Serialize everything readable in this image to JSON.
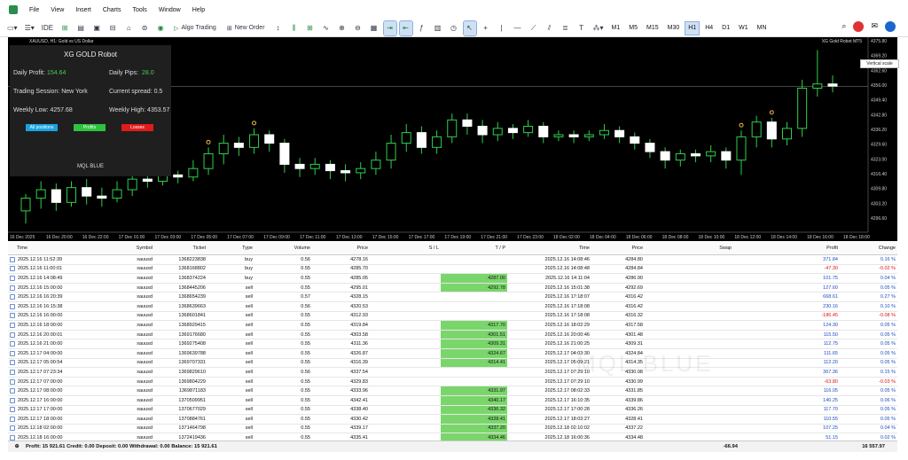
{
  "menu": [
    "File",
    "View",
    "Insert",
    "Charts",
    "Tools",
    "Window",
    "Help"
  ],
  "toolbar": {
    "algo_trading": "Algo Trading",
    "new_order": "New Order"
  },
  "timeframes": [
    "M1",
    "M5",
    "M15",
    "M30",
    "H1",
    "H4",
    "D1",
    "W1",
    "MN"
  ],
  "active_timeframe": "H1",
  "chart": {
    "symbol_label": "XAUUSD, H1:  Gold vs US Dollar",
    "robot_label": "XG Gold Robot MT5",
    "tooltip": "Vertical scale",
    "price_axis": [
      "4375.80",
      "4369.20",
      "4362.60",
      "4356.00",
      "4349.40",
      "4342.80",
      "4336.20",
      "4329.60",
      "4323.00",
      "4316.40",
      "4309.80",
      "4303.20",
      "4296.60"
    ],
    "time_axis": [
      "16 Dec 2025",
      "16 Dec 20:00",
      "16 Dec 22:00",
      "17 Dec 01:00",
      "17 Dec 03:00",
      "17 Dec 05:00",
      "17 Dec 07:00",
      "17 Dec 09:00",
      "17 Dec 11:00",
      "17 Dec 13:00",
      "17 Dec 15:00",
      "17 Dec 17:00",
      "17 Dec 19:00",
      "17 Dec 21:00",
      "17 Dec 23:00",
      "18 Dec 02:00",
      "18 Dec 04:00",
      "18 Dec 06:00",
      "18 Dec 08:00",
      "18 Dec 10:00",
      "18 Dec 12:00",
      "18 Dec 14:00",
      "18 Dec 16:00",
      "18 Dec 18:00"
    ],
    "candles": [
      [
        4298,
        4304,
        4292,
        4306
      ],
      [
        4304,
        4308,
        4299,
        4312
      ],
      [
        4308,
        4302,
        4298,
        4311
      ],
      [
        4302,
        4309,
        4300,
        4312
      ],
      [
        4309,
        4305,
        4301,
        4313
      ],
      [
        4305,
        4304,
        4300,
        4309
      ],
      [
        4304,
        4308,
        4302,
        4312
      ],
      [
        4308,
        4313,
        4305,
        4316
      ],
      [
        4313,
        4312,
        4309,
        4316
      ],
      [
        4312,
        4315,
        4310,
        4318
      ],
      [
        4315,
        4314,
        4311,
        4317
      ],
      [
        4314,
        4318,
        4312,
        4322
      ],
      [
        4318,
        4325,
        4315,
        4328
      ],
      [
        4325,
        4330,
        4320,
        4334
      ],
      [
        4330,
        4328,
        4324,
        4333
      ],
      [
        4328,
        4334,
        4325,
        4337
      ],
      [
        4334,
        4330,
        4326,
        4336
      ],
      [
        4330,
        4320,
        4316,
        4332
      ],
      [
        4320,
        4318,
        4314,
        4323
      ],
      [
        4318,
        4320,
        4315,
        4323
      ],
      [
        4320,
        4317,
        4313,
        4322
      ],
      [
        4317,
        4316,
        4312,
        4320
      ],
      [
        4316,
        4318,
        4313,
        4321
      ],
      [
        4318,
        4322,
        4315,
        4326
      ],
      [
        4322,
        4330,
        4318,
        4334
      ],
      [
        4330,
        4335,
        4326,
        4339
      ],
      [
        4335,
        4328,
        4325,
        4338
      ],
      [
        4328,
        4333,
        4325,
        4336
      ],
      [
        4333,
        4341,
        4330,
        4344
      ],
      [
        4341,
        4338,
        4334,
        4344
      ],
      [
        4338,
        4334,
        4330,
        4341
      ],
      [
        4334,
        4337,
        4331,
        4340
      ],
      [
        4337,
        4335,
        4332,
        4339
      ],
      [
        4335,
        4338,
        4333,
        4341
      ],
      [
        4338,
        4333,
        4330,
        4340
      ],
      [
        4333,
        4334,
        4331,
        4336
      ],
      [
        4334,
        4333,
        4330,
        4336
      ],
      [
        4333,
        4334,
        4331,
        4336
      ],
      [
        4334,
        4336,
        4332,
        4339
      ],
      [
        4336,
        4333,
        4330,
        4338
      ],
      [
        4333,
        4330,
        4327,
        4335
      ],
      [
        4330,
        4326,
        4323,
        4332
      ],
      [
        4326,
        4322,
        4318,
        4328
      ],
      [
        4322,
        4325,
        4319,
        4327
      ],
      [
        4325,
        4324,
        4321,
        4327
      ],
      [
        4324,
        4326,
        4321,
        4329
      ],
      [
        4326,
        4322,
        4318,
        4328
      ],
      [
        4322,
        4333,
        4315,
        4336
      ],
      [
        4333,
        4340,
        4328,
        4343
      ],
      [
        4340,
        4332,
        4328,
        4342
      ],
      [
        4332,
        4337,
        4329,
        4340
      ],
      [
        4337,
        4356,
        4333,
        4360
      ],
      [
        4356,
        4358,
        4352,
        4374
      ],
      [
        4358,
        4357,
        4354,
        4362
      ]
    ],
    "sell_markers": [
      47,
      49
    ],
    "buy_markers": [
      12,
      15
    ],
    "crosshair_price": 4356.8
  },
  "panel": {
    "title": "XG GOLD Robot",
    "daily_profit_label": "Daily Profit:",
    "daily_profit_value": "154.64",
    "daily_pips_label": "Daily Pips:",
    "daily_pips_value": "28.0",
    "trading_session": "Trading Session: New York",
    "current_spread": "Current spread: 0.5",
    "weekly_low": "Weekly Low: 4257.68",
    "weekly_high": "Weekly High: 4353.57",
    "btn_all": "All positions",
    "btn_profit": "Profits",
    "btn_loss": "Losses",
    "brand": "MQL BLUE"
  },
  "table": {
    "headers": {
      "time": "Time",
      "symbol": "Symbol",
      "ticket": "Ticket",
      "type": "Type",
      "volume": "Volume",
      "price": "Price",
      "sl": "S / L",
      "tp": "T / P",
      "ctime": "Time",
      "cprice": "Price",
      "swap": "Swap",
      "profit": "Profit",
      "change": "Change"
    },
    "rows": [
      [
        "2025.12.16 11:52:39",
        "xauusd",
        "1368223838",
        "buy",
        "0.56",
        "4278.16",
        "",
        "",
        "2025.12.16 14:08:46",
        "4284.80",
        "",
        "371.84",
        "0.16 %"
      ],
      [
        "2025.12.16 11:00:01",
        "xauusd",
        "1368168802",
        "buy",
        "0.55",
        "4285.70",
        "",
        "",
        "2025.12.16 14:08:48",
        "4284.84",
        "",
        "-47.30",
        "-0.02 %"
      ],
      [
        "2025.12.16 14:08:49",
        "xauusd",
        "1368374224",
        "buy",
        "0.55",
        "4285.05",
        "",
        "4287.00",
        "2025.12.16 14:11:04",
        "4286.90",
        "",
        "101.75",
        "0.04 %"
      ],
      [
        "2025.12.16 15:00:00",
        "xauusd",
        "1368445206",
        "sell",
        "0.55",
        "4295.01",
        "",
        "4292.78",
        "2025.12.16 15:01:38",
        "4292.69",
        "",
        "127.60",
        "0.05 %"
      ],
      [
        "2025.12.16 16:20:39",
        "xauusd",
        "1368654239",
        "sell",
        "0.57",
        "4328.15",
        "",
        "",
        "2025.12.16 17:18:07",
        "4316.42",
        "",
        "668.61",
        "0.27 %"
      ],
      [
        "2025.12.16 16:15:38",
        "xauusd",
        "1368639663",
        "sell",
        "0.56",
        "4320.53",
        "",
        "",
        "2025.12.16 17:18:08",
        "4316.42",
        "",
        "230.16",
        "0.10 %"
      ],
      [
        "2025.12.16 16:00:00",
        "xauusd",
        "1368601841",
        "sell",
        "0.55",
        "4312.93",
        "",
        "",
        "2025.12.16 17:18:08",
        "4316.32",
        "",
        "-186.45",
        "-0.08 %"
      ],
      [
        "2025.12.16 18:00:00",
        "xauusd",
        "1368929415",
        "sell",
        "0.55",
        "4319.84",
        "",
        "4317.70",
        "2025.12.16 18:02:29",
        "4317.58",
        "",
        "124.30",
        "0.05 %"
      ],
      [
        "2025.12.16 20:00:01",
        "xauusd",
        "1369176680",
        "sell",
        "0.55",
        "4303.58",
        "",
        "4301.51",
        "2025.12.16 20:00:46",
        "4301.48",
        "",
        "115.50",
        "0.05 %"
      ],
      [
        "2025.12.16 21:00:00",
        "xauusd",
        "1369275408",
        "sell",
        "0.55",
        "4311.36",
        "",
        "4309.31",
        "2025.12.16 21:00:25",
        "4309.31",
        "",
        "112.75",
        "0.05 %"
      ],
      [
        "2025.12.17 04:00:00",
        "xauusd",
        "1369639788",
        "sell",
        "0.55",
        "4326.87",
        "",
        "4324.67",
        "2025.12.17 04:03:30",
        "4324.84",
        "",
        "111.65",
        "0.05 %"
      ],
      [
        "2025.12.17 05:00:54",
        "xauusd",
        "1369707331",
        "sell",
        "0.55",
        "4316.39",
        "",
        "4314.41",
        "2025.12.17 05:09:21",
        "4314.35",
        "",
        "112.20",
        "0.05 %"
      ],
      [
        "2025.12.17 07:23:34",
        "xauusd",
        "1369829610",
        "sell",
        "0.56",
        "4337.54",
        "",
        "",
        "2025.12.17 07:29:10",
        "4330.98",
        "",
        "367.36",
        "0.15 %"
      ],
      [
        "2025.12.17 07:00:00",
        "xauusd",
        "1369804229",
        "sell",
        "0.55",
        "4329.83",
        "",
        "",
        "2025.12.17 07:29:10",
        "4330.99",
        "",
        "-63.80",
        "-0.03 %"
      ],
      [
        "2025.12.17 08:00:00",
        "xauusd",
        "1369871183",
        "sell",
        "0.55",
        "4333.96",
        "",
        "4331.97",
        "2025.12.17 08:02:33",
        "4331.85",
        "",
        "116.05",
        "0.05 %"
      ],
      [
        "2025.12.17 16:00:00",
        "xauusd",
        "1370509951",
        "sell",
        "0.55",
        "4342.41",
        "",
        "4340.17",
        "2025.12.17 16:10:35",
        "4339.86",
        "",
        "140.25",
        "0.06 %"
      ],
      [
        "2025.12.17 17:00:00",
        "xauusd",
        "1370677029",
        "sell",
        "0.55",
        "4338.40",
        "",
        "4336.32",
        "2025.12.17 17:00:28",
        "4336.26",
        "",
        "117.70",
        "0.05 %"
      ],
      [
        "2025.12.17 18:00:00",
        "xauusd",
        "1370884761",
        "sell",
        "0.55",
        "4330.42",
        "",
        "4328.41",
        "2025.12.17 18:03:27",
        "4328.41",
        "",
        "110.55",
        "0.05 %"
      ],
      [
        "2025.12.18 02:00:00",
        "xauusd",
        "1371464798",
        "sell",
        "0.55",
        "4339.17",
        "",
        "4337.20",
        "2025.12.18 02:10:02",
        "4337.22",
        "",
        "107.25",
        "0.04 %"
      ],
      [
        "2025.12.18 16:00:00",
        "xauusd",
        "1372419436",
        "sell",
        "0.55",
        "4335.41",
        "",
        "4334.46",
        "2025.12.18 16:00:36",
        "4334.48",
        "",
        "51.15",
        "0.02 %"
      ]
    ]
  },
  "footer": {
    "summary": "Profit: 15 921.61  Credit: 0.00  Deposit: 0.00  Withdrawal: 0.00  Balance: 15 921.61",
    "swap": "-66.94",
    "profit": "16 557.97"
  },
  "watermark": "MQL BLUE"
}
